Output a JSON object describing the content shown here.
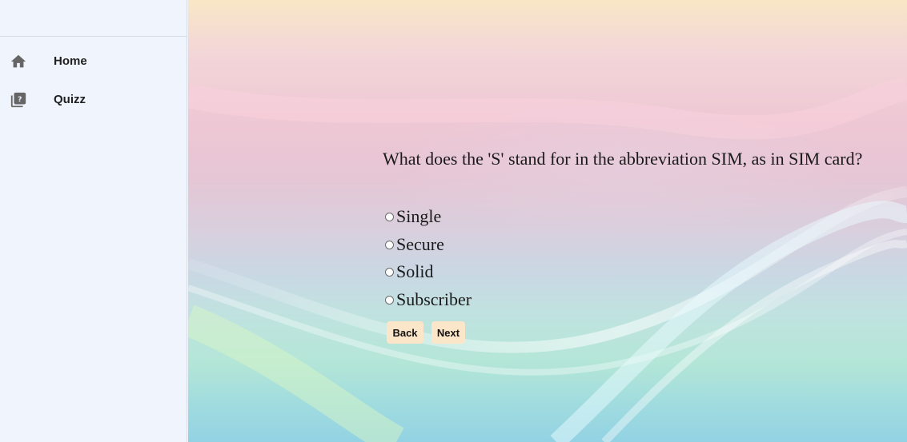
{
  "sidebar": {
    "items": [
      {
        "label": "Home",
        "icon": "home-icon"
      },
      {
        "label": "Quizz",
        "icon": "quiz-icon"
      }
    ]
  },
  "quiz": {
    "question": "What does the 'S' stand for in the abbreviation SIM, as in SIM card?",
    "options": [
      "Single",
      "Secure",
      "Solid",
      "Subscriber"
    ],
    "back_label": "Back",
    "next_label": "Next"
  },
  "colors": {
    "sidebar_bg": "#f0f4fd",
    "button_bg": "#fbe6c9",
    "icon": "#666666"
  }
}
